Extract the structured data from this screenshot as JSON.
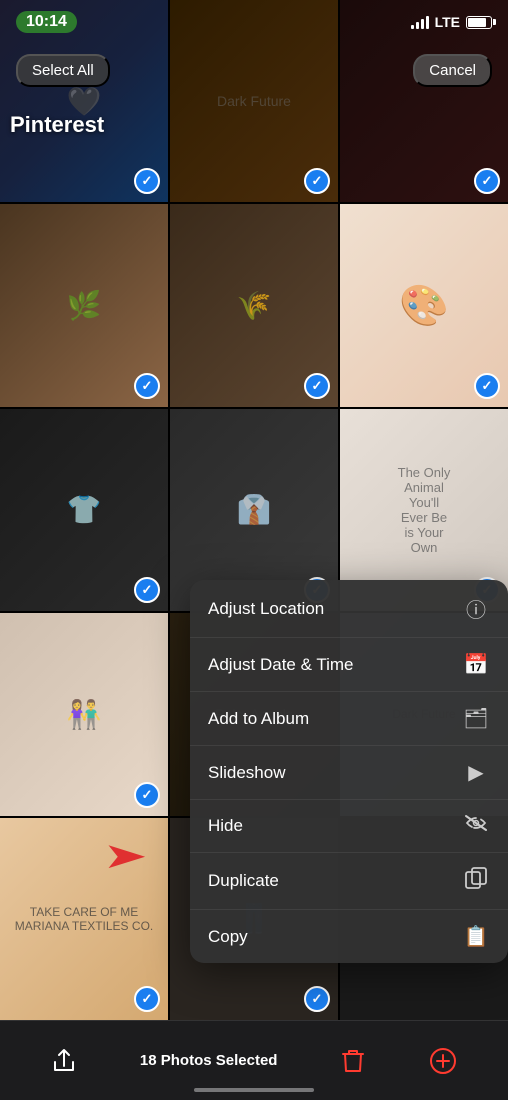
{
  "statusBar": {
    "time": "10:14",
    "carrier": "LTE"
  },
  "navBar": {
    "selectAll": "Select All",
    "title": "Pinterest",
    "cancel": "Cancel"
  },
  "contextMenu": {
    "items": [
      {
        "label": "Adjust Location",
        "icon": "ⓘ"
      },
      {
        "label": "Adjust Date & Time",
        "icon": "📅"
      },
      {
        "label": "Add to Album",
        "icon": "🗂"
      },
      {
        "label": "Slideshow",
        "icon": "▶"
      },
      {
        "label": "Hide",
        "icon": "👁"
      },
      {
        "label": "Duplicate",
        "icon": "⊞"
      },
      {
        "label": "Copy",
        "icon": "📋"
      }
    ]
  },
  "bottomBar": {
    "photosSelected": "18 Photos Selected"
  }
}
